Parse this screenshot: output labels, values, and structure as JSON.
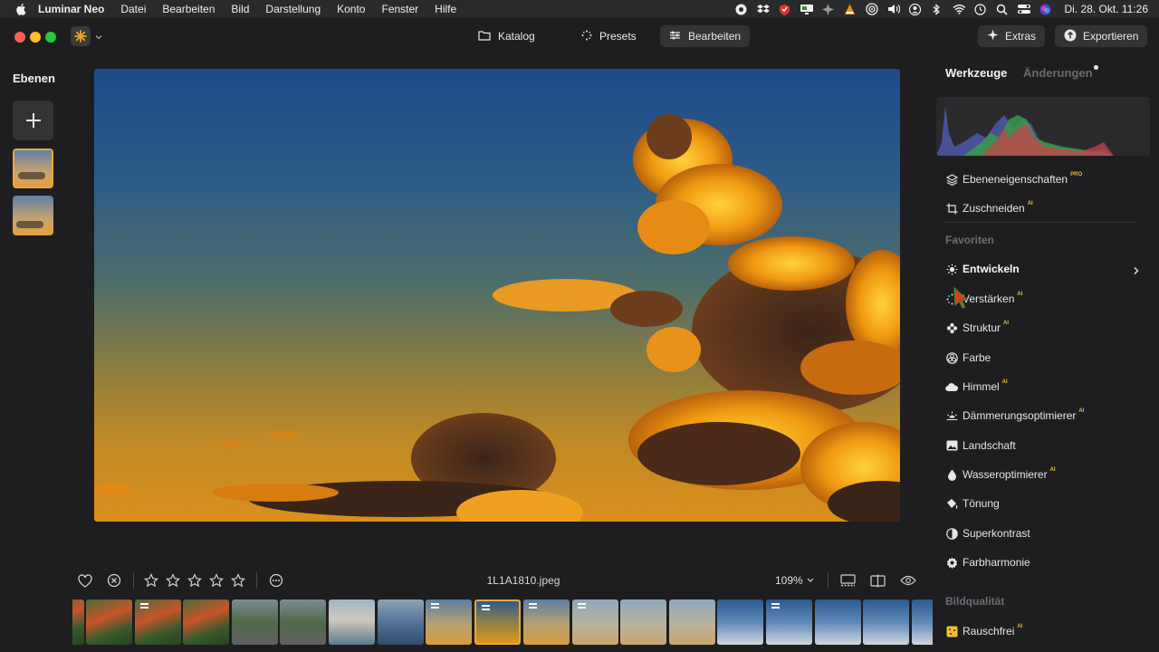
{
  "menubar": {
    "app_name": "Luminar Neo",
    "items": [
      "Datei",
      "Bearbeiten",
      "Bild",
      "Darstellung",
      "Konto",
      "Fenster",
      "Hilfe"
    ],
    "clock": "Di. 28. Okt.  11:26"
  },
  "toolbar": {
    "nav": [
      {
        "label": "Katalog",
        "icon": "folder-icon"
      },
      {
        "label": "Presets",
        "icon": "sparkle-icon"
      },
      {
        "label": "Bearbeiten",
        "icon": "sliders-icon"
      }
    ],
    "extras_label": "Extras",
    "export_label": "Exportieren"
  },
  "layers": {
    "title": "Ebenen"
  },
  "bottom": {
    "filename": "1L1A1810.jpeg",
    "zoom": "109%",
    "rating": 0
  },
  "filmstrip": {
    "selected_index": 8
  },
  "tools_panel": {
    "tab_active": "Werkzeuge",
    "tab_inactive": "Änderungen",
    "top_tools": [
      {
        "label": "Ebeneneigenschaften",
        "badge": "PRO",
        "icon": "layers-icon"
      },
      {
        "label": "Zuschneiden",
        "badge": "AI",
        "icon": "crop-icon"
      }
    ],
    "favorites_title": "Favoriten",
    "favorites": [
      {
        "label": "Entwickeln",
        "badge": "",
        "icon": "sun-icon"
      },
      {
        "label": "Verstärken",
        "badge": "AI",
        "icon": "sparkle-icon"
      },
      {
        "label": "Struktur",
        "badge": "AI",
        "icon": "flower-icon"
      },
      {
        "label": "Farbe",
        "badge": "",
        "icon": "palette-icon"
      },
      {
        "label": "Himmel",
        "badge": "AI",
        "icon": "cloud-icon"
      },
      {
        "label": "Dämmerungsoptimierer",
        "badge": "AI",
        "icon": "sunrise-icon"
      },
      {
        "label": "Landschaft",
        "badge": "",
        "icon": "landscape-icon"
      },
      {
        "label": "Wasseroptimierer",
        "badge": "AI",
        "icon": "drop-icon"
      },
      {
        "label": "Tönung",
        "badge": "",
        "icon": "bucket-icon"
      },
      {
        "label": "Superkontrast",
        "badge": "",
        "icon": "contrast-icon"
      },
      {
        "label": "Farbharmonie",
        "badge": "",
        "icon": "gear-icon"
      }
    ],
    "quality_title": "Bildqualität",
    "quality": [
      {
        "label": "Rauschfrei",
        "badge": "AI",
        "icon": "noise-icon"
      }
    ]
  },
  "colors": {
    "accent": "#e7a93a",
    "panel": "#1e1e20",
    "badge": "#e7b84a"
  }
}
